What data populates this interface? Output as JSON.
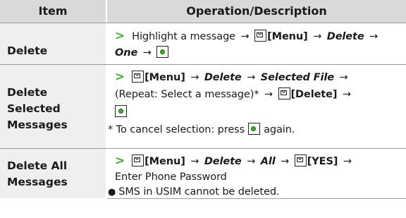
{
  "header": {
    "item": "Item",
    "operation": "Operation/Description"
  },
  "rows": [
    {
      "item": "Delete",
      "lines": {
        "l1_text": "Highlight a message",
        "menu": "[Menu]",
        "delete": "Delete",
        "one": "One"
      }
    },
    {
      "item_lines": [
        "Delete",
        "Selected",
        "Messages"
      ],
      "lines": {
        "menu": "[Menu]",
        "delete": "Delete",
        "selected_file": "Selected File",
        "repeat": "(Repeat: Select a message)*",
        "delete_key": "[Delete]",
        "note_pre": "* To cancel selection: press",
        "note_post": "again."
      }
    },
    {
      "item_lines": [
        "Delete All",
        "Messages"
      ],
      "lines": {
        "menu": "[Menu]",
        "delete": "Delete",
        "all": "All",
        "yes": "[YES]",
        "password": "Enter Phone Password",
        "note": "SMS in USIM cannot be deleted."
      }
    }
  ],
  "symbols": {
    "chevron": ">",
    "arrow": "→",
    "bullet": "●"
  },
  "colors": {
    "accent": "#3fae2a",
    "header_bg": "#d9d9d9",
    "item_bg": "#efefef"
  },
  "icons": {
    "menu_key": "envelope-key-icon",
    "center_key": "center-key-icon"
  }
}
